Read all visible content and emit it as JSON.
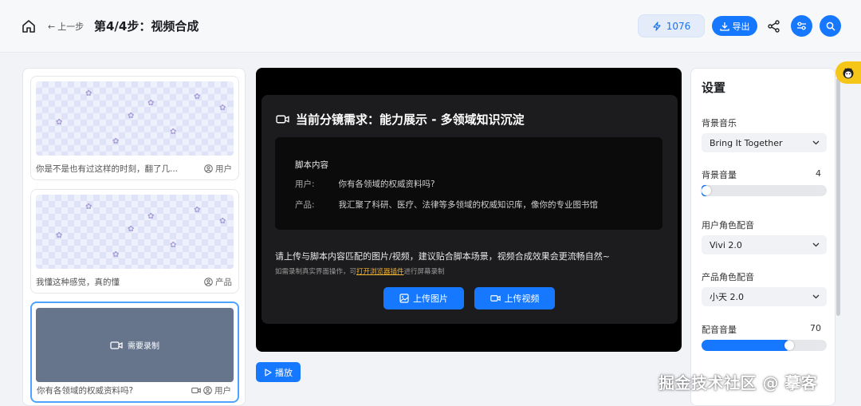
{
  "header": {
    "back_label": "上一步",
    "title": "第4/4步：视频合成",
    "credits": "1076",
    "export_label": "导出"
  },
  "shots": [
    {
      "text": "你是不是也有过这样的时刻，翻了几...",
      "role": "用户"
    },
    {
      "text": "我懂这种感觉，真的懂",
      "role": "产品"
    },
    {
      "text": "你有各领域的权威资料吗?",
      "role": "用户",
      "record_label": "需要录制"
    }
  ],
  "stage": {
    "shot_title": "当前分镜需求：能力展示 - 多领域知识沉淀",
    "script_heading": "脚本内容",
    "script_rows": [
      {
        "speaker": "用户:",
        "line": "你有各领域的权威资料吗?"
      },
      {
        "speaker": "产品:",
        "line": "我汇聚了科研、医疗、法律等多领域的权威知识库，像你的专业图书馆"
      }
    ],
    "hint": "请上传与脚本内容匹配的图片/视频，建议贴合脚本场景，视频合成效果会更流畅自然~",
    "sub_prefix": "如需录制真实界面操作，可",
    "sub_link": "打开浏览器插件",
    "sub_suffix": "进行屏幕录制",
    "upload_image_label": "上传图片",
    "upload_video_label": "上传视频",
    "play_label": "播放"
  },
  "settings": {
    "title": "设置",
    "bg_music_label": "背景音乐",
    "bg_music_value": "Bring It Together",
    "bg_volume_label": "背景音量",
    "bg_volume_value": "4",
    "user_voice_label": "用户角色配音",
    "user_voice_value": "Vivi 2.0",
    "product_voice_label": "产品角色配音",
    "product_voice_value": "小天 2.0",
    "voice_volume_label": "配音音量",
    "voice_volume_value": "70"
  },
  "watermark": "掘金技术社区 @ 摹客",
  "colors": {
    "accent": "#1677ff",
    "stage_bg": "#000000",
    "link": "#f2b233"
  },
  "icons": [
    "home-icon",
    "arrow-left-icon",
    "lightning-icon",
    "download-icon",
    "share-icon",
    "settings-sliders-icon",
    "search-icon",
    "user-circle-icon",
    "video-camera-icon",
    "image-icon",
    "play-icon",
    "chevron-down-icon"
  ]
}
